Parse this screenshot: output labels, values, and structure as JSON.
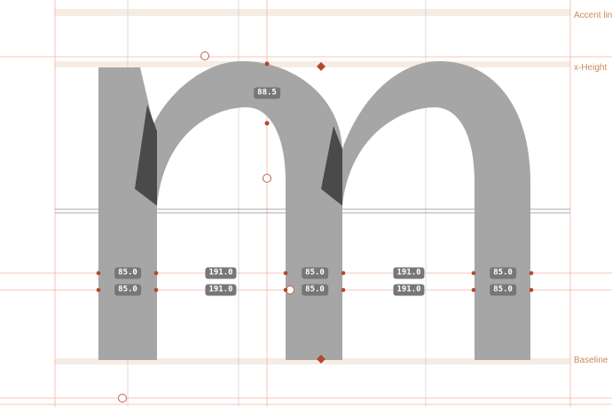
{
  "metrics": {
    "accent_line": "Accent line",
    "x_height": "x-Height",
    "baseline": "Baseline"
  },
  "measurements": {
    "curve_thickness": "88.5",
    "row1": [
      "85.0",
      "191.0",
      "85.0",
      "191.0",
      "85.0"
    ],
    "row2": [
      "85.0",
      "191.0",
      "85.0",
      "191.0",
      "85.0"
    ]
  },
  "glyph": {
    "name": "m",
    "fill": "#a6a6a6",
    "overlap_fill": "#4a4a4a"
  },
  "colors": {
    "guide": "#f2b5a5",
    "metric_band": "#f6ece4",
    "metric_text": "#c98a5b",
    "node": "#b8462c",
    "badge": "#777777"
  }
}
